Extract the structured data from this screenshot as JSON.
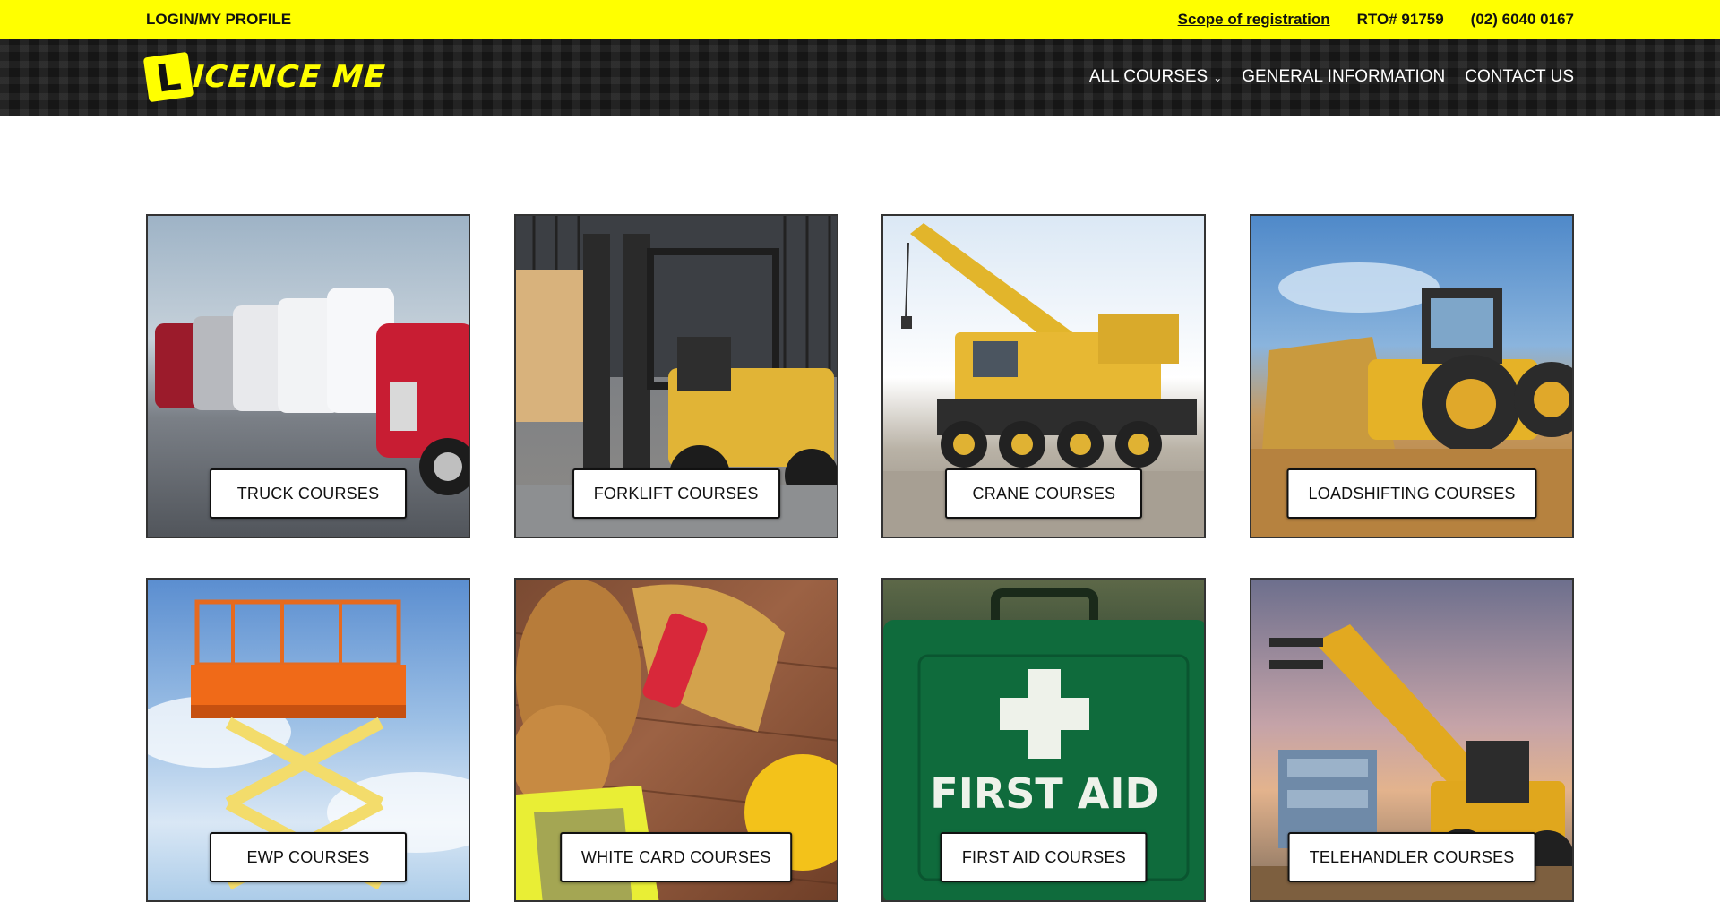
{
  "topbar": {
    "login_label": "LOGIN/MY PROFILE",
    "scope_label": "Scope of registration",
    "rto_label": "RTO# 91759",
    "phone_label": "(02) 6040 0167"
  },
  "header": {
    "logo_letter": "L",
    "logo_word": "ICENCE ME",
    "nav": {
      "all_courses": "ALL COURSES",
      "general_information": "GENERAL INFORMATION",
      "contact_us": "CONTACT US"
    }
  },
  "courses": [
    {
      "label": "TRUCK COURSES",
      "image": "truck fleet"
    },
    {
      "label": "FORKLIFT COURSES",
      "image": "forklift"
    },
    {
      "label": "CRANE COURSES",
      "image": "crane"
    },
    {
      "label": "LOADSHIFTING COURSES",
      "image": "wheel loader"
    },
    {
      "label": "EWP COURSES",
      "image": "scissor lift"
    },
    {
      "label": "WHITE CARD COURSES",
      "image": "safety gear"
    },
    {
      "label": "FIRST AID COURSES",
      "image": "first aid kit"
    },
    {
      "label": "TELEHANDLER COURSES",
      "image": "telehandler"
    }
  ],
  "firstaid_kit_text": "FIRST AID",
  "colors": {
    "brand_yellow": "#ffff00",
    "header_dark": "#202020"
  }
}
